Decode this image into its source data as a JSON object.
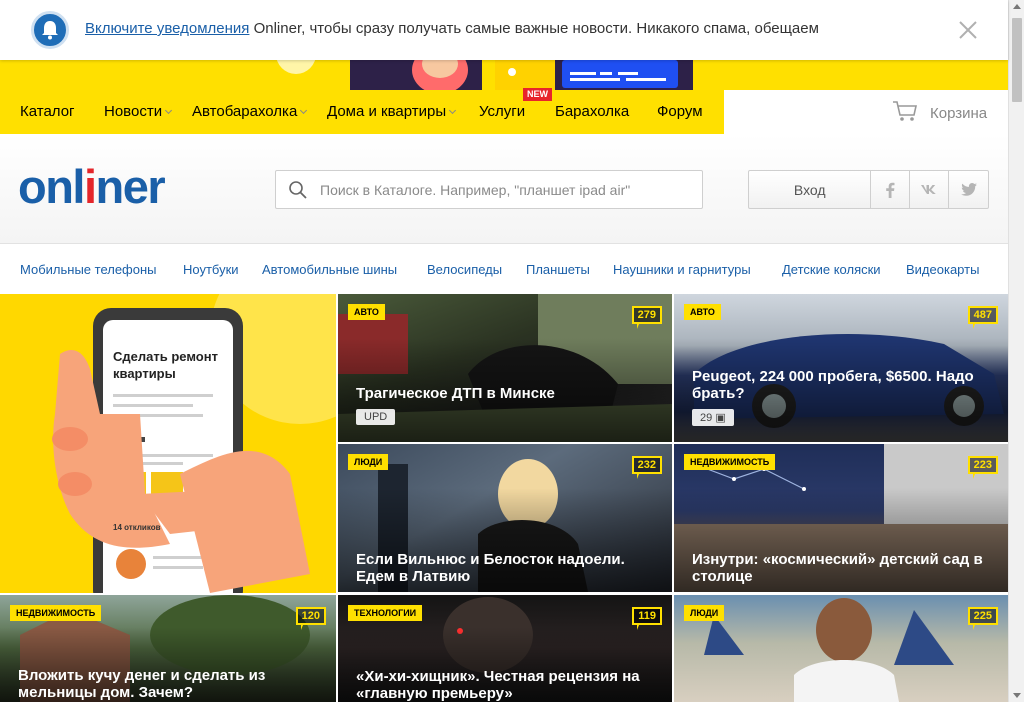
{
  "notification": {
    "link": "Включите уведомления",
    "text": " Onliner, чтобы сразу получать самые важные новости. Никакого спама, обещаем"
  },
  "nav": {
    "items": [
      "Каталог",
      "Новости",
      "Автобарахолка",
      "Дома и квартиры",
      "Услуги",
      "Барахолка",
      "Форум"
    ],
    "new_badge": "NEW",
    "cart": "Корзина"
  },
  "header": {
    "logo_pre": "onl",
    "logo_red": "i",
    "logo_post": "ner",
    "search_placeholder": "Поиск в Каталоге. Например, \"планшет ipad air\"",
    "login": "Вход",
    "social": [
      "f",
      "vk",
      "tw"
    ]
  },
  "categories": [
    "Мобильные телефоны",
    "Ноутбуки",
    "Автомобильные шины",
    "Велосипеды",
    "Планшеты",
    "Наушники и гарнитуры",
    "Детские коляски",
    "Видеокарты"
  ],
  "promo": {
    "title": "Сделать ремонт квартиры",
    "responses": "14 откликов"
  },
  "news": [
    {
      "tag": "АВТО",
      "count": "279",
      "title": "Трагическое ДТП в Минске",
      "chip": "UPD"
    },
    {
      "tag": "АВТО",
      "count": "487",
      "title": "Peugeot, 224 000 пробега, $6500. Надо брать?",
      "chip": "29"
    },
    {
      "tag": "ЛЮДИ",
      "count": "232",
      "title": "Если Вильнюс и Белосток надоели. Едем в Латвию",
      "chip": ""
    },
    {
      "tag": "НЕДВИЖИМОСТЬ",
      "count": "223",
      "title": "Изнутри: «космический» детский сад в столице",
      "chip": ""
    },
    {
      "tag": "НЕДВИЖИМОСТЬ",
      "count": "120",
      "title": "Вложить кучу денег и сделать из мельницы дом. Зачем?",
      "chip": ""
    },
    {
      "tag": "ТЕХНОЛОГИИ",
      "count": "119",
      "title": "«Хи-хи-хищник». Честная рецензия на «главную премьеру»",
      "chip": ""
    },
    {
      "tag": "ЛЮДИ",
      "count": "225",
      "title": "",
      "chip": ""
    }
  ],
  "colors": {
    "accent": "#ffe000",
    "brand": "#1a5fa8",
    "logo_red": "#e4262b"
  }
}
